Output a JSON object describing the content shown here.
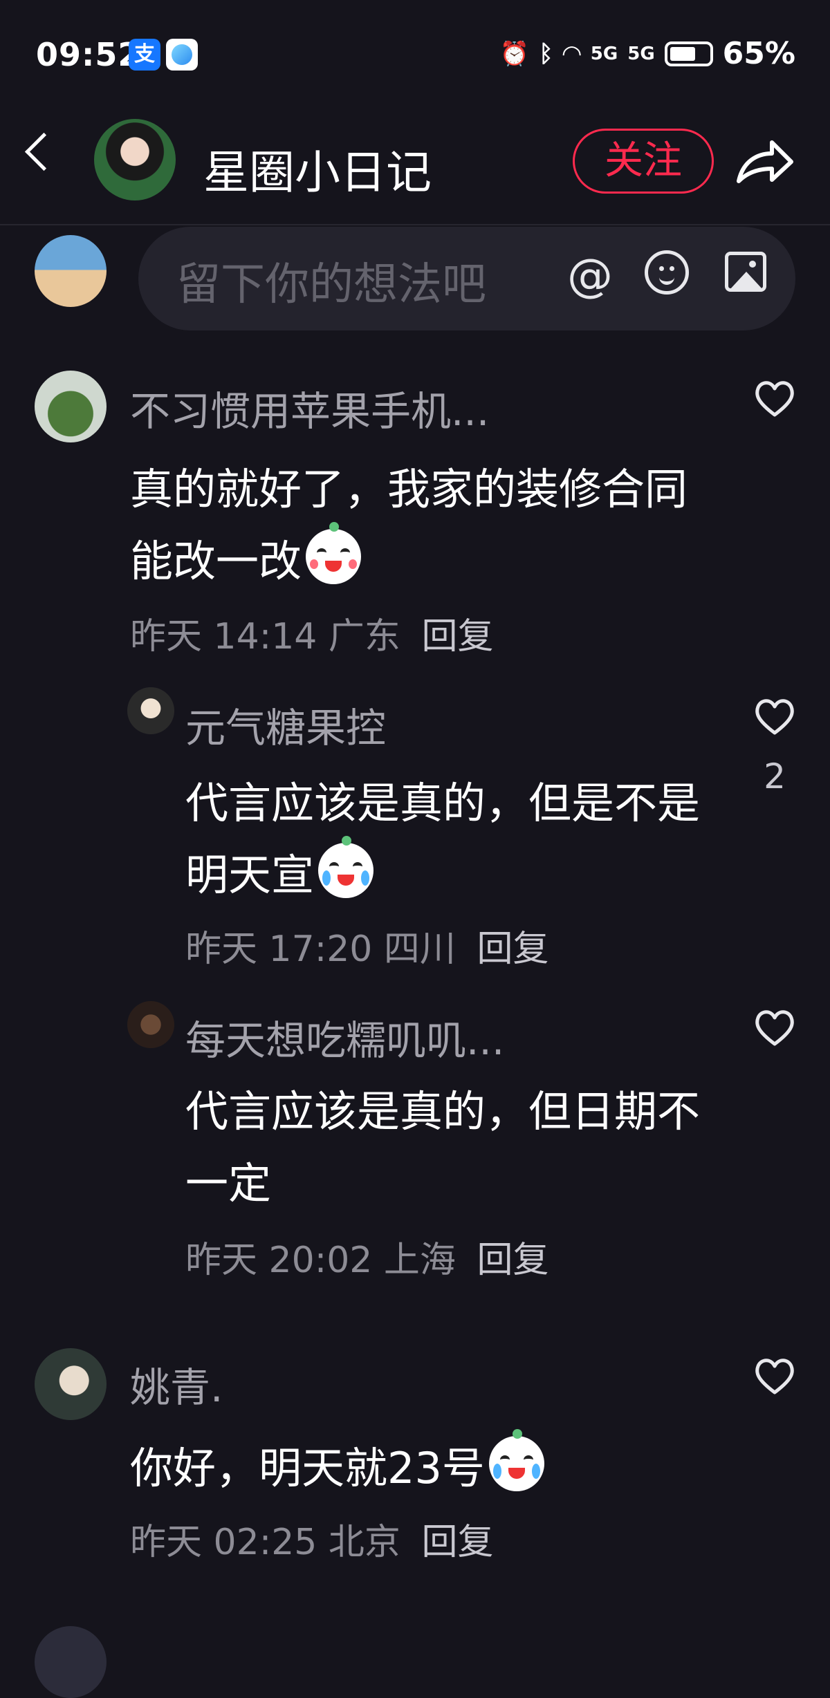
{
  "status_bar": {
    "time": "09:52",
    "alipay_badge": "支",
    "battery_percent": "65%",
    "signal_1": "5G",
    "signal_2": "5G"
  },
  "header": {
    "title": "星圈小日记",
    "follow_label": "关注"
  },
  "input": {
    "placeholder": "留下你的想法吧",
    "at_symbol": "@"
  },
  "comments": [
    {
      "name": "不习惯用苹果手机...",
      "text": "真的就好了，我家的装修合同能改一改",
      "time": "昨天 14:14",
      "location": "广东",
      "reply": "回复"
    },
    {
      "name": "元气糖果控",
      "text": "代言应该是真的，但是不是明天宣",
      "time": "昨天 17:20",
      "location": "四川",
      "reply": "回复",
      "likes": "2"
    },
    {
      "name": "每天想吃糯叽叽...",
      "text": "代言应该是真的，但日期不一定",
      "time": "昨天 20:02",
      "location": "上海",
      "reply": "回复"
    },
    {
      "name": "姚青.",
      "text": "你好，明天就23号",
      "time": "昨天 02:25",
      "location": "北京",
      "reply": "回复"
    }
  ],
  "colors": {
    "background": "#15141c",
    "accent": "#ff2a4e",
    "input_bg": "#24232d"
  }
}
